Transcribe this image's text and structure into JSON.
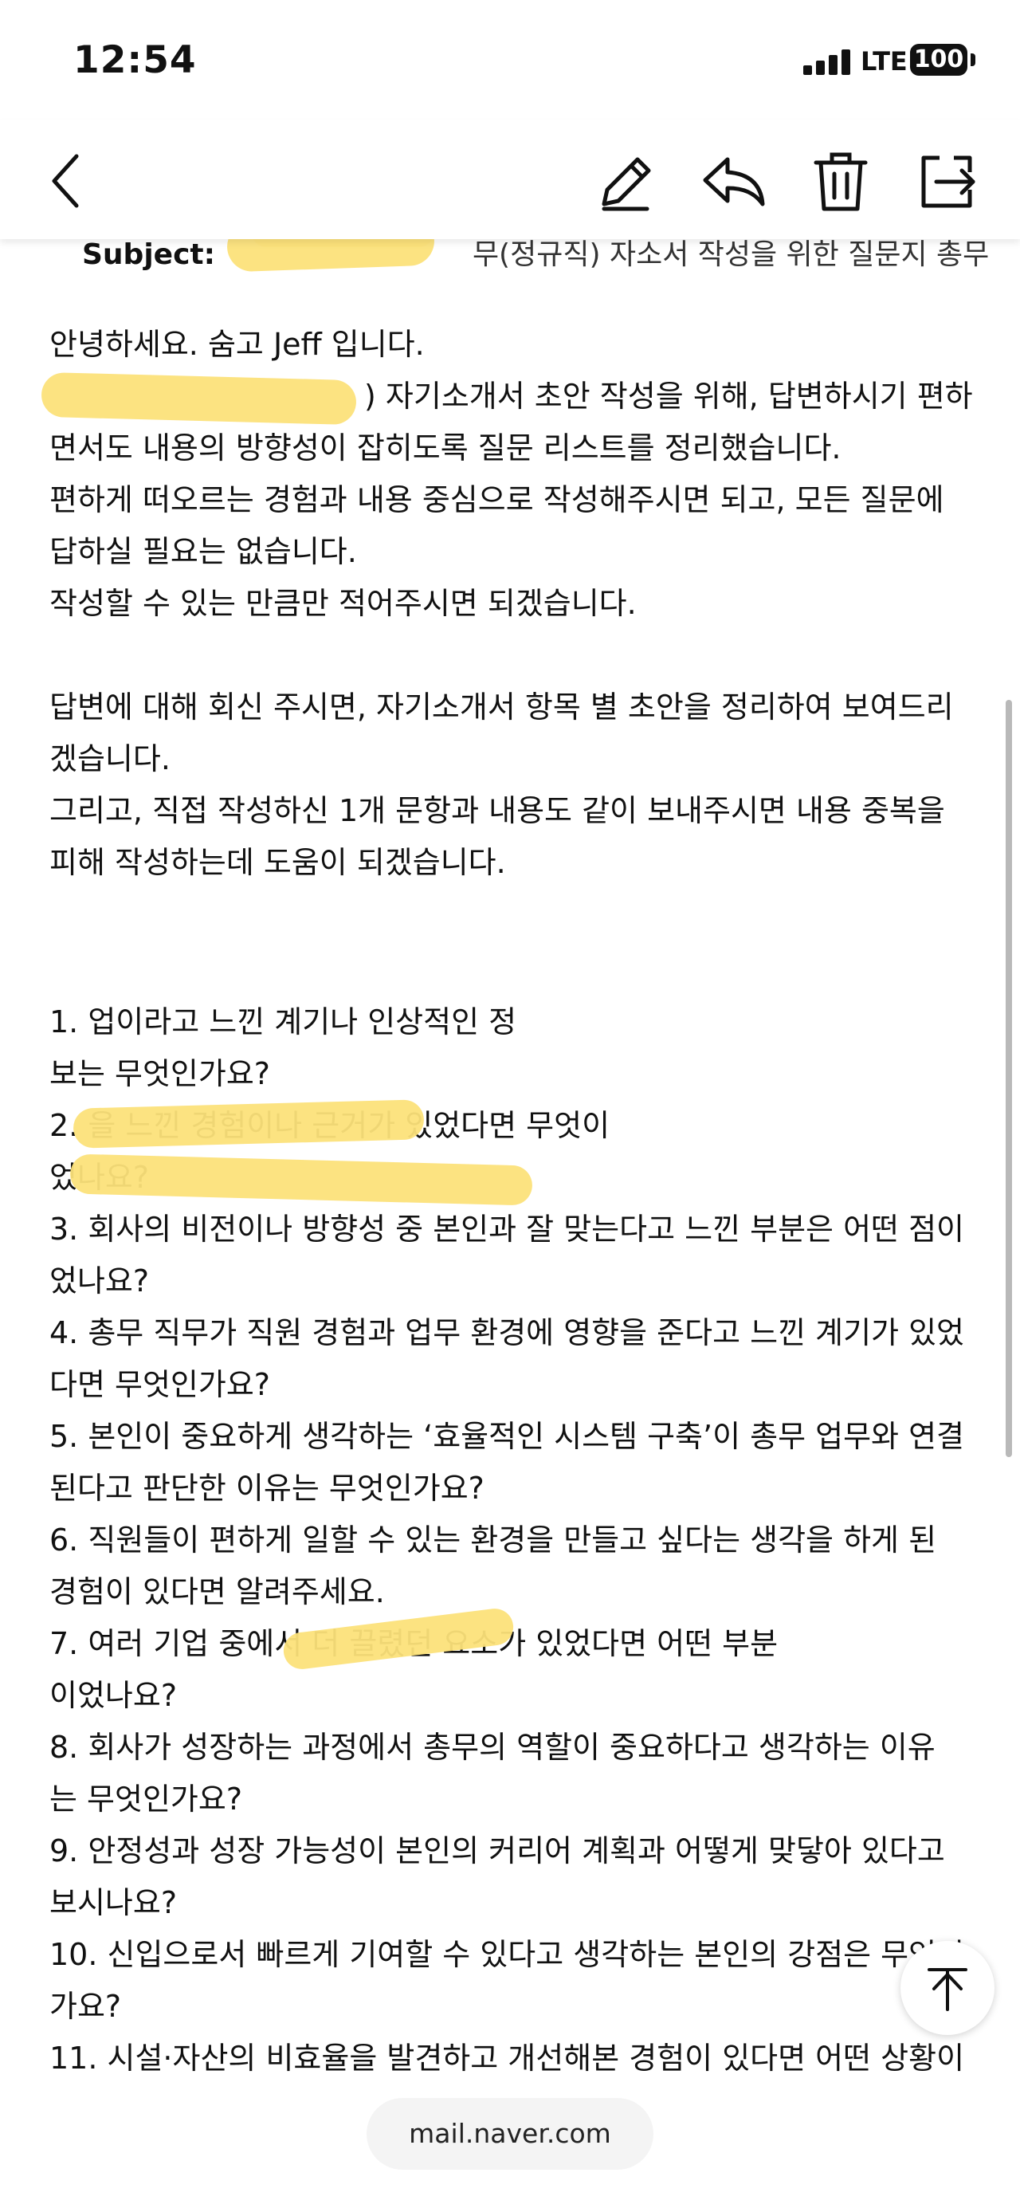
{
  "status": {
    "time": "12:54",
    "network": "LTE",
    "battery": "100"
  },
  "toolbar": {
    "back_icon": "chevron-left-icon",
    "edit_icon": "pencil-icon",
    "reply_icon": "reply-icon",
    "delete_icon": "trash-icon",
    "move_icon": "move-folder-icon"
  },
  "email": {
    "subject_label": "Subject:",
    "subject_tail": "무(정규직) 자소서 작성을 위한 질문지 총무",
    "intro": [
      "안녕하세요. 숨고 Jeff 입니다.",
      ") 자기소개서 초안 작성을 위해, 답변하시기 편하",
      "면서도 내용의 방향성이 잡히도록 질문 리스트를 정리했습니다.",
      "편하게 떠오르는 경험과 내용 중심으로 작성해주시면 되고, 모든 질문에",
      "답하실 필요는 없습니다.",
      "작성할 수 있는 만큼만 적어주시면 되겠습니다."
    ],
    "followup": [
      "답변에 대해 회신 주시면, 자기소개서 항목 별 초안을 정리하여 보여드리",
      "겠습니다.",
      "그리고, 직접 작성하신 1개 문항과 내용도 같이 보내주시면 내용 중복을",
      "피해 작성하는데 도움이 되겠습니다."
    ],
    "questions": [
      "1.                              업이라고 느낀 계기나 인상적인 정",
      "보는 무엇인가요?",
      "2.                          을 느낀 경험이나 근거가 있었다면 무엇이",
      "었나요?",
      "3. 회사의 비전이나 방향성 중 본인과 잘 맞는다고 느낀 부분은 어떤 점이",
      "었나요?",
      "4. 총무 직무가 직원 경험과 업무 환경에 영향을 준다고 느낀 계기가 있었",
      "다면 무엇인가요?",
      "5. 본인이 중요하게 생각하는 ‘효율적인 시스템 구축’이 총무 업무와 연결",
      "된다고 판단한 이유는 무엇인가요?",
      "6. 직원들이 편하게 일할 수 있는 환경을 만들고 싶다는 생각을 하게 된",
      "경험이 있다면 알려주세요.",
      "7. 여러 기업 중에서               더 끌렸던 요소가 있었다면 어떤 부분",
      "이었나요?",
      "8. 회사가 성장하는 과정에서 총무의 역할이 중요하다고 생각하는 이유",
      "는 무엇인가요?",
      "9. 안정성과 성장 가능성이 본인의 커리어 계획과 어떻게 맞닿아 있다고",
      "보시나요?",
      "10. 신입으로서 빠르게 기여할 수 있다고 생각하는 본인의 강점은 무엇인",
      "가요?",
      "11. 시설·자산의 비효율을 발견하고 개선해본 경험이 있다면 어떤 상황이"
    ]
  },
  "scroll_top_icon": "arrow-up-icon",
  "url": "mail.naver.com"
}
